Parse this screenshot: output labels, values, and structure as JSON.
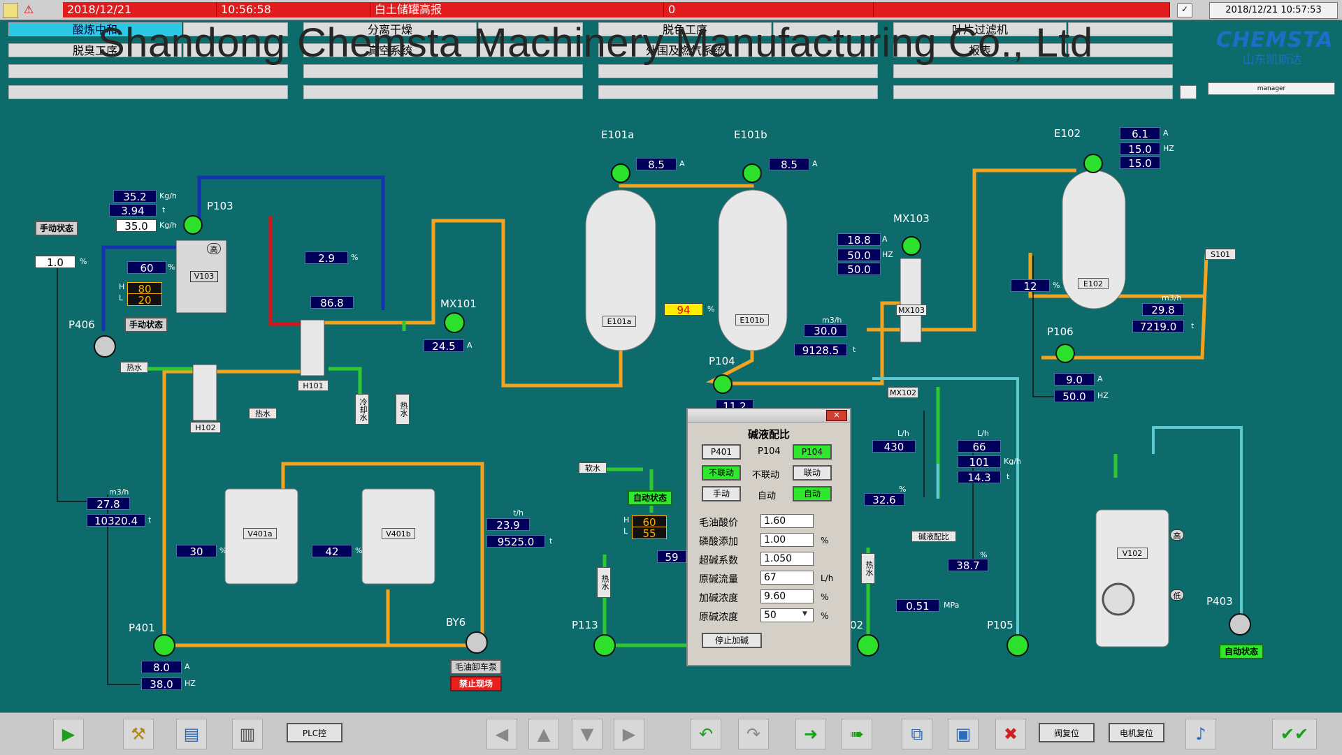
{
  "topbar": {
    "alarm_date": "2018/12/21",
    "alarm_time": "10:56:58",
    "alarm_text": "白土储罐高报",
    "alarm_count": "0",
    "clock": "2018/12/21 10:57:53"
  },
  "menu": {
    "row1": [
      "酸炼中和",
      "分离干燥",
      "脱色工序",
      "叶片过滤机"
    ],
    "row2": [
      "脱臭工序",
      "真空系统",
      "外围及燃气系统",
      "报表"
    ]
  },
  "watermark": "Shandong Chemsta Machinery Manufacturing Co., Ltd",
  "logo": {
    "en": "CHEMSTA",
    "cn": "山东凯斯达"
  },
  "user": "manager",
  "process": {
    "p103": {
      "label": "P103",
      "flow": "35.2",
      "flow_unit": "Kg/h",
      "total": "3.94",
      "total_unit": "t",
      "setpoint": "35.0",
      "set_unit": "Kg/h",
      "mode": "手动状态",
      "pct": "1.0",
      "pct_unit": "%"
    },
    "v103": {
      "label": "V103",
      "level": "60",
      "hi": "80",
      "lo": "20",
      "high_tag": "高",
      "mode": "手动状态",
      "H": "H",
      "L": "L"
    },
    "p406": {
      "label": "P406"
    },
    "valve_steam": {
      "value": "2.9",
      "unit": "%",
      "temp": "86.8"
    },
    "mx101": {
      "label": "MX101",
      "current": "24.5",
      "unit": "A"
    },
    "h101": "H101",
    "h102": "H102",
    "hot_water": "热水",
    "cold_water": "冷却水",
    "e101a": {
      "label": "E101a",
      "current": "8.5",
      "unit": "A",
      "tag": "E101a"
    },
    "e101b": {
      "label": "E101b",
      "current": "8.5",
      "unit": "A",
      "tag": "E101b"
    },
    "e101_level": {
      "value": "94",
      "unit": "%"
    },
    "p104": {
      "label": "P104",
      "flow_unit": "m3/h",
      "flow": "30.0",
      "total": "9128.5",
      "total_unit": "t"
    },
    "mx103": {
      "label": "MX103",
      "current": "18.8",
      "freq": "50.0",
      "freq2": "50.0",
      "tag": "MX103"
    },
    "mx102": "MX102",
    "e102": {
      "label": "E102",
      "current": "6.1",
      "freq": "15.0",
      "freq2": "15.0",
      "level": "12",
      "tag": "E102"
    },
    "s101": "S101",
    "p106": {
      "label": "P106",
      "flow_unit": "m3/h",
      "flow": "29.8",
      "total": "7219.0",
      "current": "9.0",
      "freq": "50.0"
    },
    "v401a": {
      "tag": "V401a",
      "level": "30"
    },
    "v401b": {
      "tag": "V401b",
      "level": "42"
    },
    "p401": {
      "label": "P401",
      "flow_unit": "m3/h",
      "flow": "27.8",
      "total": "10320.4",
      "current": "8.0",
      "freq": "38.0"
    },
    "by6": {
      "label": "BY6",
      "flow_unit": "t/h",
      "flow": "23.9",
      "total": "9525.0",
      "tag1": "毛油卸车泵",
      "tag2": "禁止现场"
    },
    "soft_water": "软水",
    "auto_state": "自动状态",
    "hl": {
      "H": "60",
      "L": "55",
      "extra": "59"
    },
    "p113": "P113",
    "p102": "02",
    "pressure": {
      "value": "0.51",
      "unit": "MPa"
    },
    "lye": {
      "flow1_unit": "L/h",
      "flow1": "430",
      "flow2_unit": "L/h",
      "flow2": "66",
      "k": "101",
      "k_unit": "Kg/h",
      "t": "14.3",
      "t_unit": "t",
      "pct1": "32.6",
      "pct2": "38.7",
      "tag": "碱液配比"
    },
    "v102": {
      "tag": "V102",
      "high": "高",
      "low": "低"
    },
    "p105": "P105",
    "p403": {
      "label": "P403",
      "mode": "自动状态"
    },
    "p104_small": "11.2"
  },
  "dialog": {
    "title": "碱液配比",
    "p401": "P401",
    "p104": "P104",
    "p104_btn": "P104",
    "unlinked_btn": "不联动",
    "unlinked": "不联动",
    "linked_btn": "联动",
    "manual_btn": "手动",
    "auto": "自动",
    "auto_btn": "自动",
    "rows": [
      {
        "label": "毛油酸价",
        "value": "1.60",
        "unit": ""
      },
      {
        "label": "磷酸添加",
        "value": "1.00",
        "unit": "%"
      },
      {
        "label": "超碱系数",
        "value": "1.050",
        "unit": ""
      },
      {
        "label": "原碱流量",
        "value": "67",
        "unit": "L/h"
      },
      {
        "label": "加碱浓度",
        "value": "9.60",
        "unit": "%"
      },
      {
        "label": "原碱浓度",
        "value": "50",
        "unit": "%"
      }
    ],
    "stop_btn": "停止加碱"
  },
  "bottombar": {
    "plc": "PLC控",
    "valve_reset": "阀复位",
    "motor_reset": "电机复位"
  }
}
